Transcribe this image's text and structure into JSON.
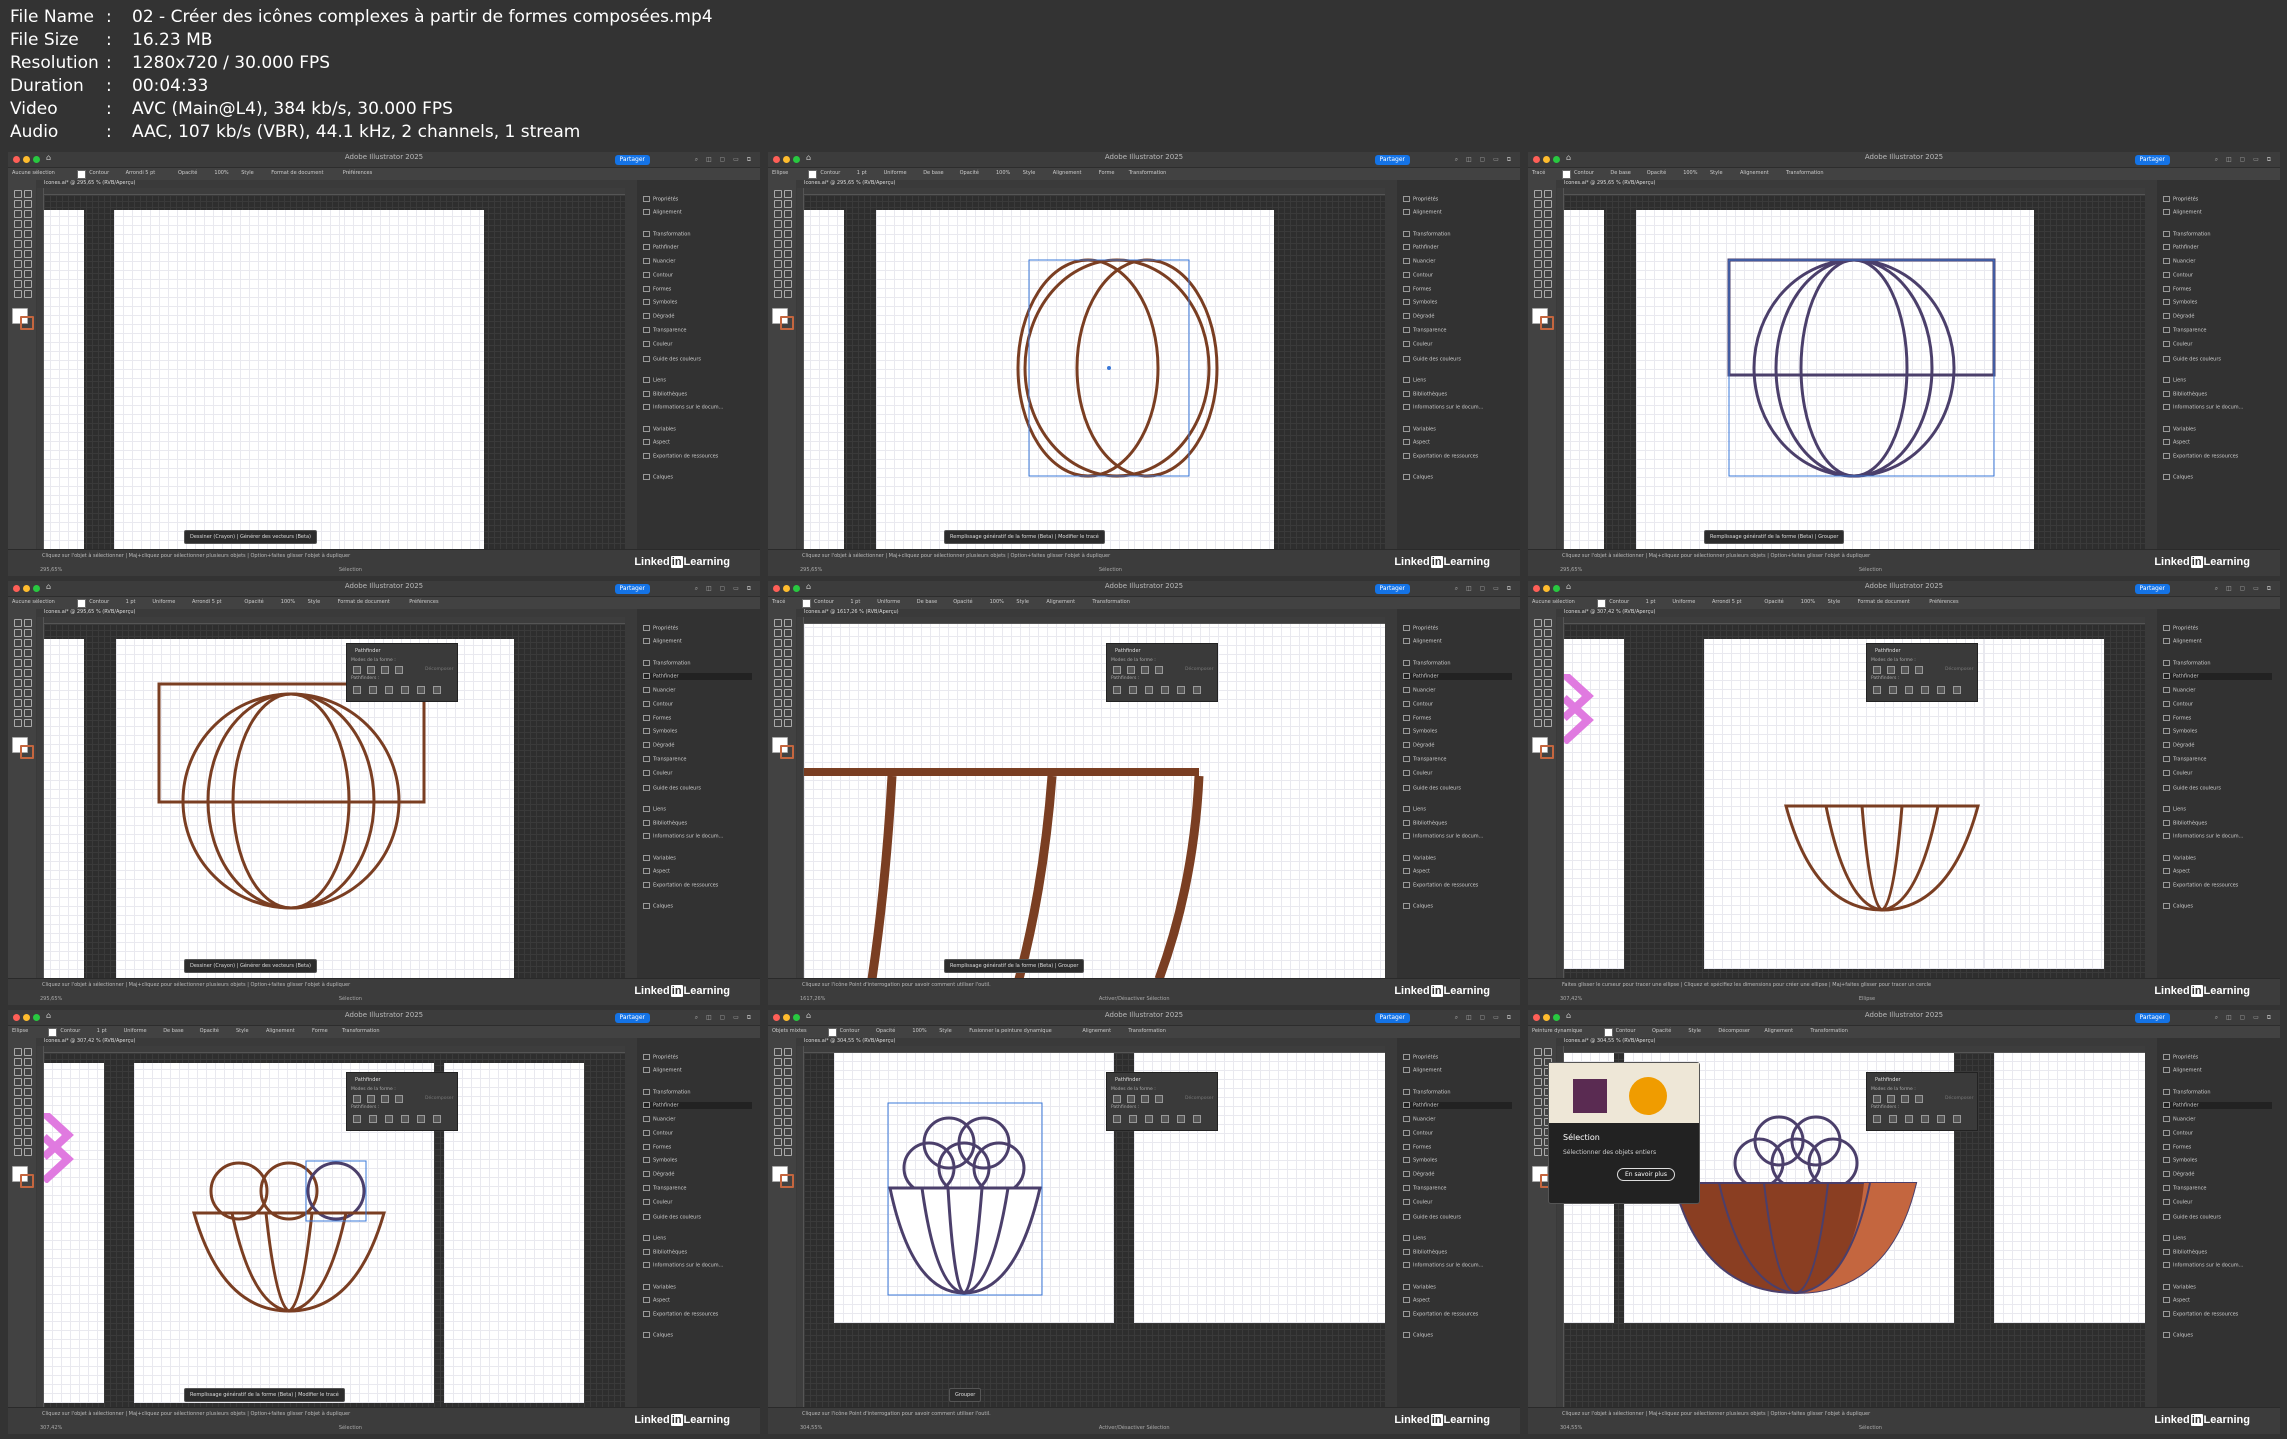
{
  "file_info": [
    {
      "label": "File Name",
      "value": "02 - Créer des icônes complexes à partir de formes composées.mp4"
    },
    {
      "label": "File Size",
      "value": "16.23 MB"
    },
    {
      "label": "Resolution",
      "value": "1280x720 / 30.000 FPS"
    },
    {
      "label": "Duration",
      "value": "00:04:33"
    },
    {
      "label": "Video",
      "value": "AVC (Main@L4), 384 kb/s, 30.000 FPS"
    },
    {
      "label": "Audio",
      "value": "AAC, 107 kb/s (VBR), 44.1 kHz, 2 channels, 1 stream"
    }
  ],
  "common": {
    "app_title": "Adobe Illustrator 2025",
    "share_label": "Partager",
    "brand": "LinkedIn Learning",
    "brand_left": "Linked",
    "brand_in": "in",
    "brand_right": "Learning",
    "panel_items": [
      "Propriétés",
      "Alignement",
      "Transformation",
      "Pathfinder",
      "Nuancier",
      "Contour",
      "Formes",
      "Symboles",
      "Dégradé",
      "Transparence",
      "Couleur",
      "Guide des couleurs",
      "Liens",
      "Bibliothèques",
      "Informations sur le docum...",
      "Variables",
      "Aspect",
      "Exportation de ressources",
      "Calques"
    ],
    "pathfinder": {
      "title": "Pathfinder",
      "modes": "Modes de la forme :",
      "pathfinders": "Pathfinders :",
      "expand": "Décomposer"
    },
    "tooltip": {
      "title": "Sélection",
      "desc": "Sélectionner des objets entiers",
      "button": "En savoir plus"
    },
    "colors": {
      "accent": "#1473e6",
      "stroke_brown": "#7a3e22",
      "stroke_purple": "#4b3f6b",
      "fill_brown": "#8a3e22",
      "fill_orange": "#c4663f",
      "swatch_purple": "#5a2b52",
      "swatch_orange": "#f09c00",
      "pink": "#e07ae0"
    }
  },
  "frames": [
    {
      "doc": "Icones.ai* @ 295,65 % (RVB/Aperçu)",
      "zoom": "295,65%",
      "status": "Cliquez sur l'objet à sélectionner | Maj+cliquez pour sélectionner plusieurs objets | Option+faites glisser l'objet à dupliquer",
      "sel": "Sélection",
      "ctrl": [
        "Aucune sélection",
        "Contour",
        "Arrondi 5 pt",
        "Opacité",
        "100%",
        "Style",
        "Format de document",
        "Préférences"
      ],
      "ctx": "Dessiner (Crayon) | Générer des vecteurs (Beta)"
    },
    {
      "doc": "Icones.ai* @ 295,65 % (RVB/Aperçu)",
      "zoom": "295,65%",
      "status": "Cliquez sur l'objet à sélectionner | Maj+cliquez pour sélectionner plusieurs objets | Option+faites glisser l'objet à dupliquer",
      "sel": "Sélection",
      "ctrl": [
        "Ellipse",
        "Contour",
        "1 pt",
        "Uniforme",
        "De base",
        "Opacité",
        "100%",
        "Style",
        "Alignement",
        "Forme",
        "Transformation"
      ],
      "ctx": "Remplissage génératif de la forme (Beta) | Modifier le tracé"
    },
    {
      "doc": "Icones.ai* @ 295,65 % (RVB/Aperçu)",
      "zoom": "295,65%",
      "status": "Cliquez sur l'objet à sélectionner | Maj+cliquez pour sélectionner plusieurs objets | Option+faites glisser l'objet à dupliquer",
      "sel": "Sélection",
      "ctrl": [
        "Tracé",
        "Contour",
        "De base",
        "Opacité",
        "100%",
        "Style",
        "Alignement",
        "Transformation"
      ],
      "ctx": "Remplissage génératif de la forme (Beta) | Grouper"
    },
    {
      "doc": "Icones.ai* @ 295,65 % (RVB/Aperçu)",
      "zoom": "295,65%",
      "status": "Cliquez sur l'objet à sélectionner | Maj+cliquez pour sélectionner plusieurs objets | Option+faites glisser l'objet à dupliquer",
      "sel": "Sélection",
      "ctrl": [
        "Aucune sélection",
        "Contour",
        "1 pt",
        "Uniforme",
        "Arrondi 5 pt",
        "Opacité",
        "100%",
        "Style",
        "Format de document",
        "Préférences"
      ],
      "ctx": "Dessiner (Crayon) | Générer des vecteurs (Beta)"
    },
    {
      "doc": "Icones.ai* @ 1617,26 % (RVB/Aperçu)",
      "zoom": "1617,26%",
      "status": "Cliquez sur l'icône Point d'interrogation pour savoir comment utiliser l'outil.",
      "sel": "Activer/Désactiver Sélection",
      "ctrl": [
        "Tracé",
        "Contour",
        "1 pt",
        "Uniforme",
        "De base",
        "Opacité",
        "100%",
        "Style",
        "Alignement",
        "Transformation"
      ],
      "ctx": "Remplissage génératif de la forme (Beta) | Grouper"
    },
    {
      "doc": "Icones.ai* @ 307,42 % (RVB/Aperçu)",
      "zoom": "307,42%",
      "status": "Faites glisser le curseur pour tracer une ellipse | Cliquez et spécifiez les dimensions pour créer une ellipse | Maj+faites glisser pour tracer un cercle",
      "sel": "Ellipse",
      "ctrl": [
        "Aucune sélection",
        "Contour",
        "1 pt",
        "Uniforme",
        "Arrondi 5 pt",
        "Opacité",
        "100%",
        "Style",
        "Format de document",
        "Préférences"
      ],
      "ctx": ""
    },
    {
      "doc": "Icones.ai* @ 307,42 % (RVB/Aperçu)",
      "zoom": "307,42%",
      "status": "Cliquez sur l'objet à sélectionner | Maj+cliquez pour sélectionner plusieurs objets | Option+faites glisser l'objet à dupliquer",
      "sel": "Sélection",
      "ctrl": [
        "Ellipse",
        "Contour",
        "1 pt",
        "Uniforme",
        "De base",
        "Opacité",
        "Style",
        "Alignement",
        "Forme",
        "Transformation"
      ],
      "ctx": "Remplissage génératif de la forme (Beta) | Modifier le tracé"
    },
    {
      "doc": "Icones.ai* @ 304,55 % (RVB/Aperçu)",
      "zoom": "304,55%",
      "status": "Cliquez sur l'icône Point d'interrogation pour savoir comment utiliser l'outil.",
      "sel": "Activer/Désactiver Sélection",
      "ctrl": [
        "Objets mixtes",
        "Contour",
        "Opacité",
        "100%",
        "Style",
        "Fusionner la peinture dynamique",
        "Alignement",
        "Transformation"
      ],
      "ctx": "Grouper"
    },
    {
      "doc": "Icones.ai* @ 304,55 % (RVB/Aperçu)",
      "zoom": "304,55%",
      "status": "Cliquez sur l'objet à sélectionner | Maj+cliquez pour sélectionner plusieurs objets | Option+faites glisser l'objet à dupliquer",
      "sel": "Sélection",
      "ctrl": [
        "Peinture dynamique",
        "Contour",
        "Opacité",
        "Style",
        "Décomposer",
        "Alignement",
        "Transformation"
      ],
      "ctx": ""
    }
  ]
}
